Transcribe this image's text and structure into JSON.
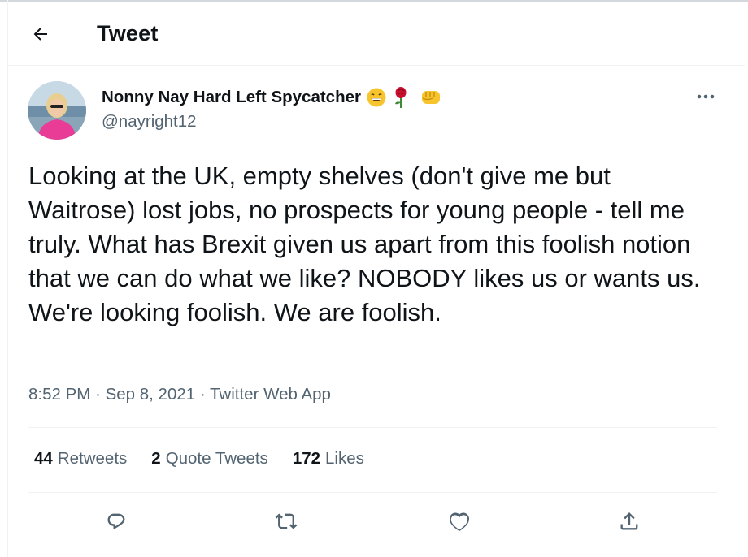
{
  "header": {
    "title": "Tweet"
  },
  "author": {
    "name": "Nonny Nay Hard Left Spycatcher",
    "handle": "@nayright12",
    "emojis": [
      "grinning-face-emoji",
      "rose-emoji",
      "fist-emoji"
    ]
  },
  "tweet": {
    "text": "Looking at the UK, empty shelves (don't give me but Waitrose) lost jobs, no prospects for young people - tell me truly. What has Brexit given us apart from this foolish notion that we can do what we like? NOBODY likes us or wants us. We're looking foolish. We are foolish.",
    "time": "8:52 PM",
    "separator": "·",
    "date": "Sep 8, 2021",
    "source": "Twitter Web App"
  },
  "stats": {
    "retweets_count": "44",
    "retweets_label": "Retweets",
    "quotes_count": "2",
    "quotes_label": "Quote Tweets",
    "likes_count": "172",
    "likes_label": "Likes"
  },
  "actions": [
    "reply-icon",
    "retweet-icon",
    "like-icon",
    "share-icon"
  ],
  "colors": {
    "text": "#0f1419",
    "secondary": "#536471",
    "divider": "#eff3f4"
  }
}
